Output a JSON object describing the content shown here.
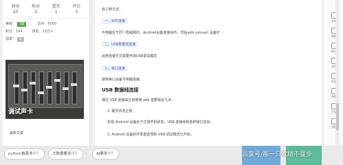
{
  "profile": {
    "stats": [
      {
        "name": "原创",
        "value": "25"
      },
      {
        "name": "粉丝",
        "value": "2"
      },
      {
        "name": "喜欢",
        "value": "1"
      },
      {
        "name": "评论",
        "value": "3"
      }
    ],
    "level_label": "等级：",
    "level_badge": "3级",
    "visits": "访问：6000",
    "points_label": "积分：194",
    "rank": "排名：19万+",
    "medal_label": "勋章：",
    "recent_title": "最新文章"
  },
  "photo": {
    "caption": "调试声卡"
  },
  "tags": [
    "python嵌套多少？",
    "大数据要多少？",
    "AI要多少？"
  ],
  "article": {
    "lines": [
      {
        "type": "p",
        "text": "有三种方法："
      },
      {
        "type": "hl",
        "text": "一、WiFi连接"
      },
      {
        "type": "p",
        "text": "与电脑位于同一局域网内，Android设备连接WiFi，然后adb connect 设备IP"
      },
      {
        "type": "hl",
        "text": "二、USB数据线连接"
      },
      {
        "type": "p",
        "text": "此种连接方式需要开启USB调试模式"
      },
      {
        "type": "hl",
        "text": "三、串口连接"
      },
      {
        "type": "p",
        "text": "使用串口设备与电脑连接。"
      },
      {
        "type": "h",
        "text": "USB 数据线连接"
      },
      {
        "type": "p",
        "text": "通过 USB 连接来正常使用 adb 需要保证几点："
      },
      {
        "type": "p",
        "text": "1. 硬件状态正常。"
      },
      {
        "type": "p",
        "text": "包括 Android 设备处于正常开机状态，USB 连接线和各种接口完好。"
      },
      {
        "type": "p",
        "text": "2. Android 设备的开发者选项和 USB 调试模式已开启。"
      }
    ]
  },
  "rail": [
    "分享",
    "收藏",
    "评论",
    "点赞",
    "打赏",
    "举报",
    "目录",
    "顶部"
  ],
  "watermark": "百家号/那一只欢精不曼步"
}
